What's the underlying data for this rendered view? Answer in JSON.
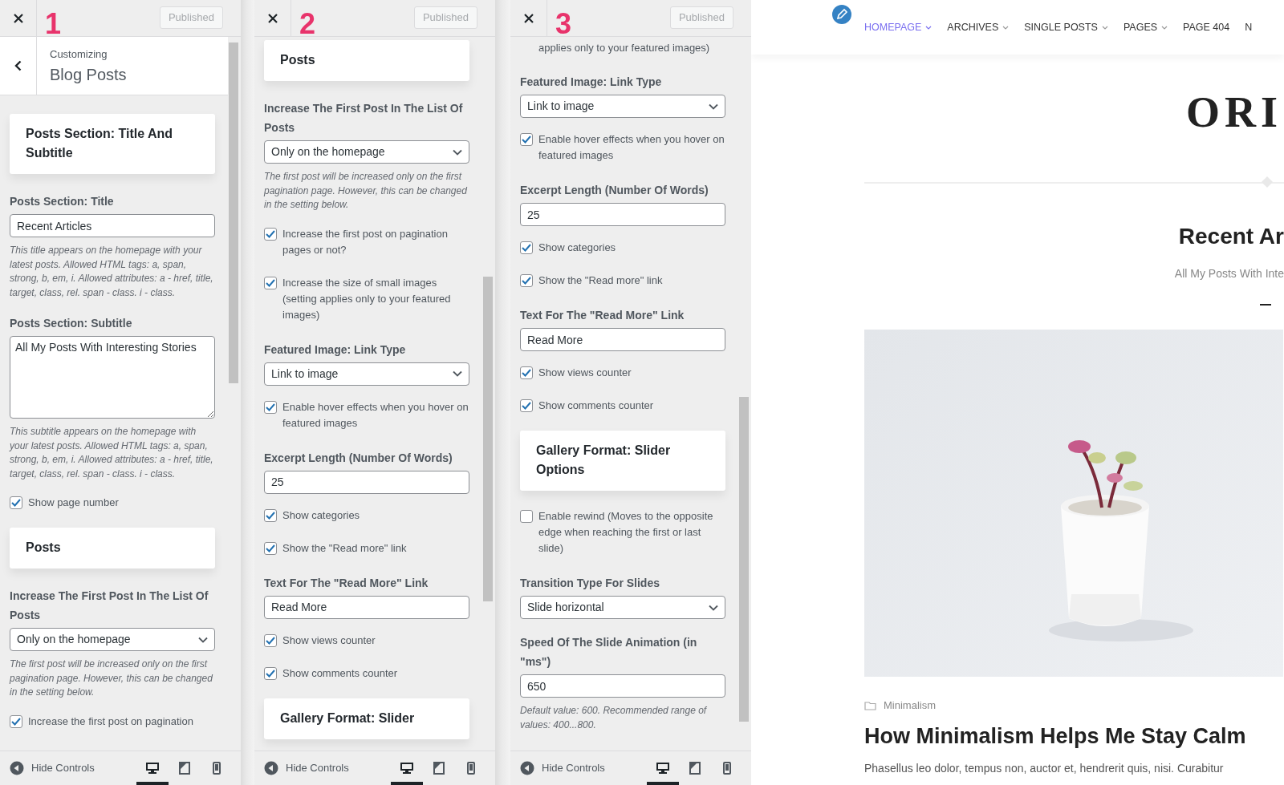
{
  "panels": [
    {
      "number": "1",
      "publish_button": "Published",
      "subheader": {
        "context": "Customizing",
        "title": "Blog Posts"
      },
      "controls": [
        {
          "kind": "section",
          "title": "Posts Section: Title And Subtitle"
        },
        {
          "kind": "field",
          "label": "Posts Section: Title",
          "value": "Recent Articles",
          "hint": "This title appears on the homepage with your latest posts. Allowed HTML tags: a, span, strong, b, em, i. Allowed attributes: a - href, title, target, class, rel. span - class. i - class."
        },
        {
          "kind": "textarea",
          "label": "Posts Section: Subtitle",
          "value": "All My Posts With Interesting Stories",
          "hint": "This subtitle appears on the homepage with your latest posts. Allowed HTML tags: a, span, strong, b, em, i. Allowed attributes: a - href, title, target, class, rel. span - class. i - class."
        },
        {
          "kind": "checkbox",
          "label": "Show page number",
          "checked": true
        },
        {
          "kind": "section",
          "title": "Posts"
        },
        {
          "kind": "select",
          "label": "Increase The First Post In The List Of Posts",
          "value": "Only on the homepage",
          "hint": "The first post will be increased only on the first pagination page. However, this can be changed in the setting below."
        },
        {
          "kind": "checkbox",
          "label": "Increase the first post on pagination",
          "checked": true
        }
      ],
      "footer": {
        "hide_label": "Hide Controls",
        "devices": [
          {
            "kind": "desktop",
            "selected": true
          },
          {
            "kind": "tablet",
            "selected": false
          },
          {
            "kind": "mobile",
            "selected": false
          }
        ]
      }
    },
    {
      "number": "2",
      "publish_button": "Published",
      "controls": [
        {
          "kind": "section",
          "title": "Posts"
        },
        {
          "kind": "select",
          "label": "Increase The First Post In The List Of Posts",
          "value": "Only on the homepage",
          "hint": "The first post will be increased only on the first pagination page. However, this can be changed in the setting below."
        },
        {
          "kind": "checkbox",
          "label": "Increase the first post on pagination pages or not?",
          "checked": true
        },
        {
          "kind": "checkbox",
          "label": "Increase the size of small images (setting applies only to your featured images)",
          "checked": true
        },
        {
          "kind": "select",
          "label": "Featured Image: Link Type",
          "value": "Link to image"
        },
        {
          "kind": "checkbox",
          "label": "Enable hover effects when you hover on featured images",
          "checked": true
        },
        {
          "kind": "field",
          "label": "Excerpt Length (Number Of Words)",
          "value": "25"
        },
        {
          "kind": "checkbox",
          "label": "Show categories",
          "checked": true
        },
        {
          "kind": "checkbox",
          "label": "Show the \"Read more\" link",
          "checked": true
        },
        {
          "kind": "field",
          "label": "Text For The \"Read More\" Link",
          "value": "Read More"
        },
        {
          "kind": "checkbox",
          "label": "Show views counter",
          "checked": true
        },
        {
          "kind": "checkbox",
          "label": "Show comments counter",
          "checked": true
        },
        {
          "kind": "section",
          "title": "Gallery Format: Slider"
        }
      ],
      "footer": {
        "hide_label": "Hide Controls",
        "devices": [
          {
            "kind": "desktop",
            "selected": true
          },
          {
            "kind": "tablet",
            "selected": false
          },
          {
            "kind": "mobile",
            "selected": false
          }
        ]
      }
    },
    {
      "number": "3",
      "publish_button": "Published",
      "controls": [
        {
          "kind": "fragment",
          "text": "applies only to your featured images)"
        },
        {
          "kind": "select",
          "label": "Featured Image: Link Type",
          "value": "Link to image"
        },
        {
          "kind": "checkbox",
          "label": "Enable hover effects when you hover on featured images",
          "checked": true
        },
        {
          "kind": "field",
          "label": "Excerpt Length (Number Of Words)",
          "value": "25"
        },
        {
          "kind": "checkbox",
          "label": "Show categories",
          "checked": true
        },
        {
          "kind": "checkbox",
          "label": "Show the \"Read more\" link",
          "checked": true
        },
        {
          "kind": "field",
          "label": "Text For The \"Read More\" Link",
          "value": "Read More"
        },
        {
          "kind": "checkbox",
          "label": "Show views counter",
          "checked": true
        },
        {
          "kind": "checkbox",
          "label": "Show comments counter",
          "checked": true
        },
        {
          "kind": "section",
          "title": "Gallery Format: Slider Options"
        },
        {
          "kind": "checkbox",
          "label": "Enable rewind (Moves to the opposite edge when reaching the first or last slide)",
          "checked": false
        },
        {
          "kind": "select",
          "label": "Transition Type For Slides",
          "value": "Slide horizontal"
        },
        {
          "kind": "field",
          "label": "Speed Of The Slide Animation (in \"ms\")",
          "value": "650",
          "hint": "Default value: 600. Recommended range of values: 400...800."
        }
      ],
      "footer": {
        "hide_label": "Hide Controls",
        "devices": [
          {
            "kind": "desktop",
            "selected": true
          },
          {
            "kind": "tablet",
            "selected": false
          },
          {
            "kind": "mobile",
            "selected": false
          }
        ]
      }
    }
  ],
  "preview": {
    "menu": [
      {
        "label": "HOMEPAGE",
        "selected": true,
        "dropdown": true
      },
      {
        "label": "ARCHIVES",
        "selected": false,
        "dropdown": true
      },
      {
        "label": "SINGLE POSTS",
        "selected": false,
        "dropdown": true
      },
      {
        "label": "PAGES",
        "selected": false,
        "dropdown": true
      },
      {
        "label": "PAGE 404",
        "selected": false,
        "dropdown": false
      },
      {
        "label": "N",
        "selected": false,
        "dropdown": false
      }
    ],
    "logo": "ORI",
    "heading": "Recent Ar",
    "subheading": "All My Posts With Inte",
    "post": {
      "category": "Minimalism",
      "title": "How Minimalism Helps Me Stay Calm",
      "excerpt": "Phasellus leo dolor, tempus non, auctor et, hendrerit quis, nisi. Curabitur"
    }
  }
}
